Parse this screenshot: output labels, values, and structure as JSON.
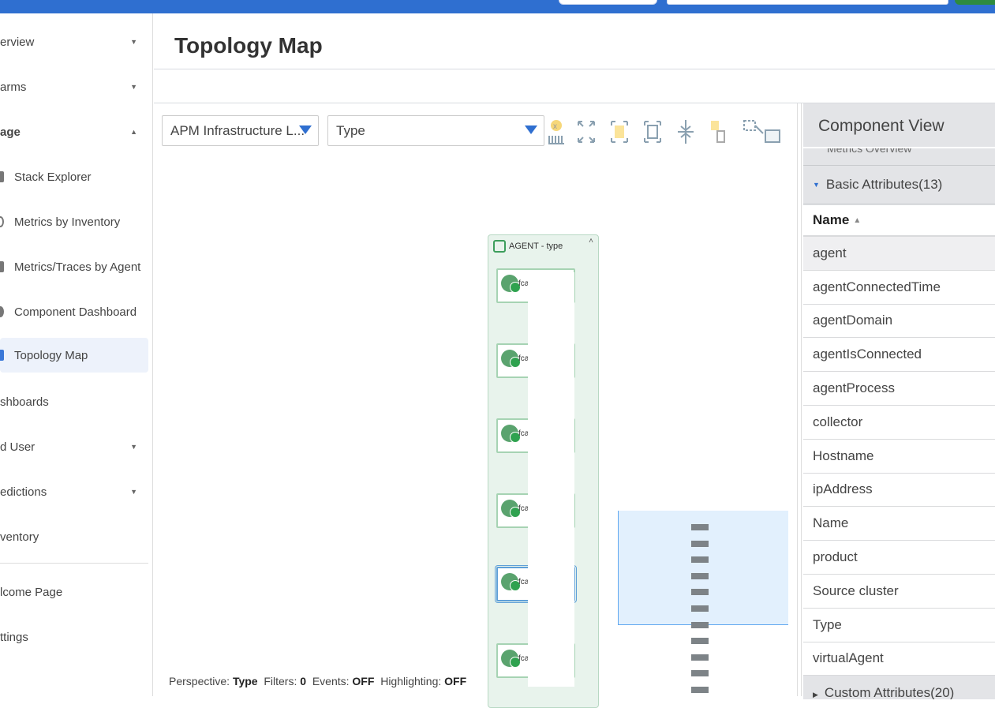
{
  "page_title": "Topology Map",
  "sidebar": {
    "items": [
      {
        "label": "erview",
        "expand": "down"
      },
      {
        "label": "arms",
        "expand": "down"
      },
      {
        "label": "age",
        "expand": "up"
      },
      {
        "label": "Stack Explorer"
      },
      {
        "label": "Metrics by Inventory"
      },
      {
        "label": "Metrics/Traces by Agent"
      },
      {
        "label": "Component Dashboard"
      },
      {
        "label": "Topology Map"
      },
      {
        "label": "shboards"
      },
      {
        "label": "d User",
        "expand": "down"
      },
      {
        "label": "edictions",
        "expand": "down"
      },
      {
        "label": "ventory"
      },
      {
        "label": "lcome Page"
      },
      {
        "label": "ttings"
      }
    ]
  },
  "toolbar": {
    "layer_select": "APM Infrastructure L...",
    "perspective_select": "Type",
    "tools": [
      "clear-filter-icon",
      "expand-all-icon",
      "expand-selected-icon",
      "fit-to-view-icon",
      "collapse-icon",
      "move-selected-icon",
      "select-area-icon"
    ]
  },
  "map": {
    "group_label": "AGENT - type",
    "node_label": "fca",
    "node_count": 6
  },
  "status": {
    "perspective_label": "Perspective:",
    "perspective": "Type",
    "filters_label": "Filters:",
    "filters": "0",
    "events_label": "Events:",
    "events": "OFF",
    "highlighting_label": "Highlighting:",
    "highlighting": "OFF"
  },
  "component_view": {
    "title": "Component View",
    "sub_label": "Metrics Overview",
    "section": "Basic Attributes(13)",
    "column": "Name",
    "rows": [
      "agent",
      "agentConnectedTime",
      "agentDomain",
      "agentIsConnected",
      "agentProcess",
      "collector",
      "Hostname",
      "ipAddress",
      "Name",
      "product",
      "Source cluster",
      "Type",
      "virtualAgent"
    ],
    "footer_section": "Custom Attributes(20)"
  }
}
